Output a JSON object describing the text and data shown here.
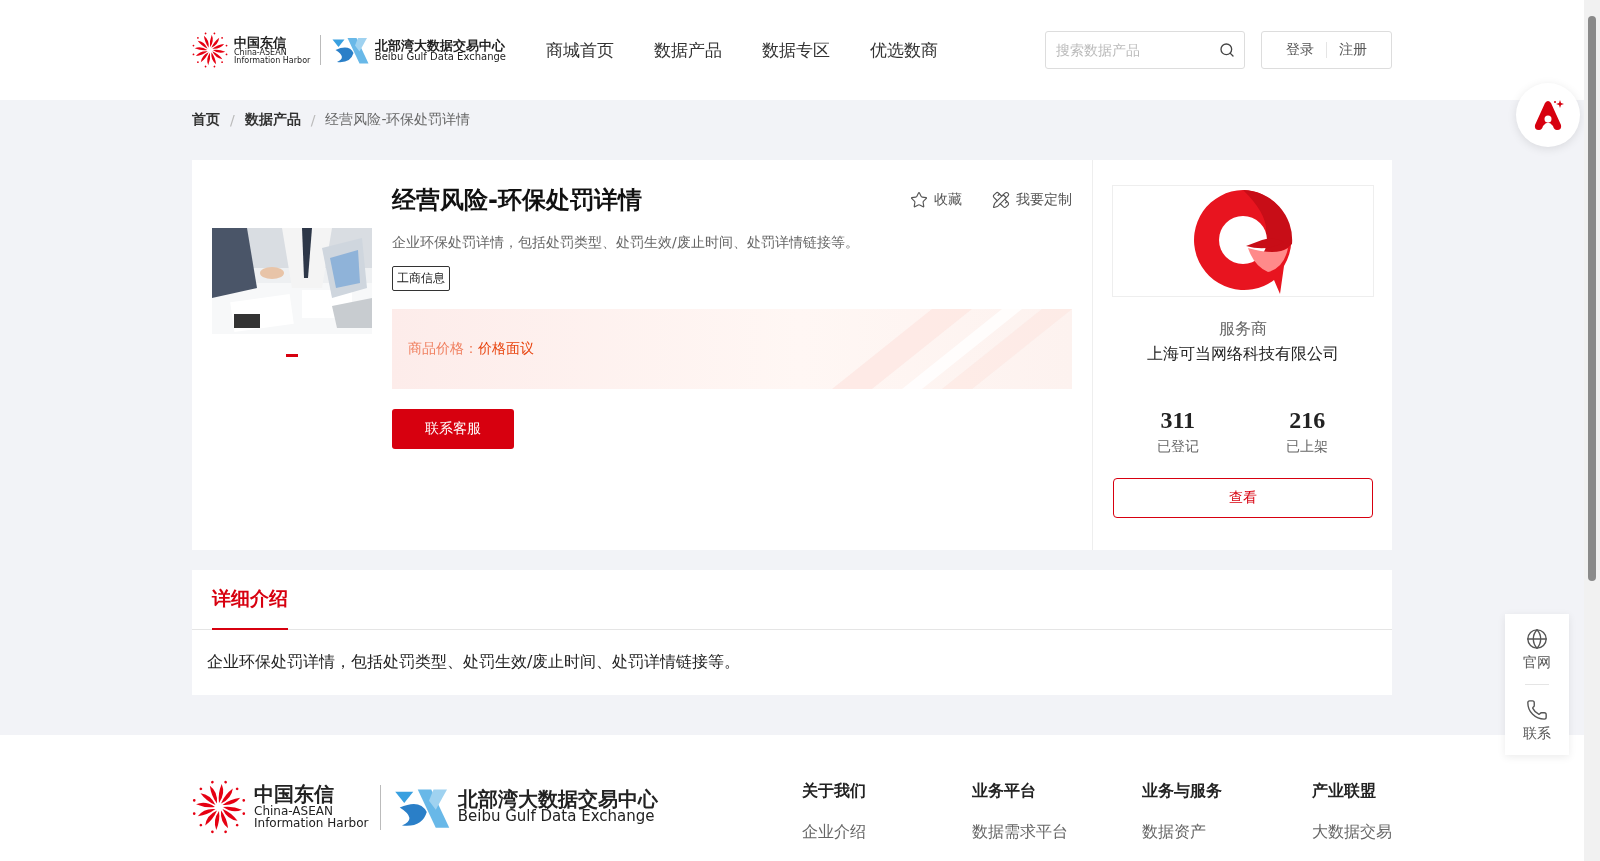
{
  "header": {
    "logo": {
      "cn_name": "中国东信",
      "en_name": "China-ASEAN",
      "en_sub": "Information Harbor",
      "exchange_cn": "北部湾大数据交易中心",
      "exchange_en": "Beibu Gulf Data Exchange"
    },
    "nav": [
      {
        "label": "商城首页",
        "selected": false
      },
      {
        "label": "数据产品",
        "selected": false
      },
      {
        "label": "数据专区",
        "selected": false
      },
      {
        "label": "优选数商",
        "selected": false
      }
    ],
    "search": {
      "placeholder": "搜索数据产品"
    },
    "auth": [
      "登录",
      "注册"
    ]
  },
  "breadcrumb": {
    "separator": "/",
    "items": [
      "首页",
      "数据产品",
      "经营风险-环保处罚详情"
    ]
  },
  "product": {
    "title": "经营风险-环保处罚详情",
    "description": "企业环保处罚详情，包括处罚类型、处罚生效/废止时间、处罚详情链接等。",
    "tags": [
      "工商信息"
    ],
    "actions": [
      {
        "kind": "star",
        "label": "收藏"
      },
      {
        "kind": "customize",
        "label": "我要定制"
      }
    ],
    "price_label": "商品价格：",
    "price_value": "价格面议",
    "contact_button": "联系客服",
    "carousel": [
      {
        "selected": true
      }
    ]
  },
  "provider": {
    "role": "服务商",
    "name": "上海可当网络科技有限公司",
    "stats": [
      {
        "value": "311",
        "label": "已登记"
      },
      {
        "value": "216",
        "label": "已上架"
      }
    ],
    "view_button": "查看"
  },
  "detail": {
    "tabs": [
      {
        "label": "详细介绍",
        "selected": true
      }
    ],
    "text": "企业环保处罚详情，包括处罚类型、处罚生效/废止时间、处罚详情链接等。"
  },
  "side_panel": [
    {
      "kind": "globe",
      "label": "官网"
    },
    {
      "kind": "phone",
      "label": "联系"
    }
  ],
  "footer": {
    "logo": {
      "cn_name": "中国东信",
      "en_name": "China-ASEAN",
      "en_sub": "Information Harbor",
      "exchange_cn": "北部湾大数据交易中心",
      "exchange_en": "Beibu Gulf Data Exchange"
    },
    "columns": [
      {
        "title": "关于我们",
        "links": [
          "企业介绍"
        ]
      },
      {
        "title": "业务平台",
        "links": [
          "数据需求平台"
        ]
      },
      {
        "title": "业务与服务",
        "links": [
          "数据资产"
        ]
      },
      {
        "title": "产业联盟",
        "links": [
          "大数据交易"
        ]
      }
    ]
  }
}
